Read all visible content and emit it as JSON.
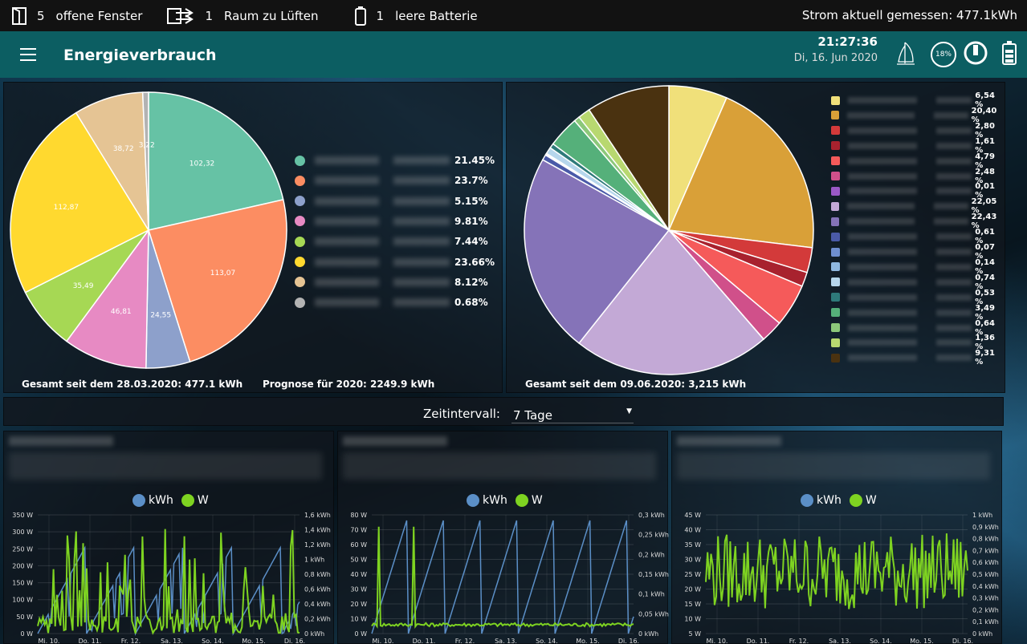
{
  "topbar": {
    "windows_count": "5",
    "windows_label": "offene Fenster",
    "rooms_count": "1",
    "rooms_label": "Raum zu Lüften",
    "battery_count": "1",
    "battery_label": "leere Batterie",
    "power_label": "Strom aktuell gemessen: 477.1kWh"
  },
  "header": {
    "title": "Energieverbrauch",
    "time": "21:27:36",
    "date": "Di, 16. Jun 2020",
    "percent_badge": "18%"
  },
  "pie1": {
    "footer_total": "Gesamt seit dem 28.03.2020: 477.1 kWh",
    "footer_forecast": "Prognose für 2020: 2249.9 kWh",
    "slices": [
      {
        "value": "102,32",
        "color": "#66c2a5",
        "pct": "21.45%"
      },
      {
        "value": "113,07",
        "color": "#fc8d62",
        "pct": "23.7%"
      },
      {
        "value": "24,55",
        "color": "#8da0cb",
        "pct": "5.15%"
      },
      {
        "value": "46,81",
        "color": "#e78ac3",
        "pct": "9.81%"
      },
      {
        "value": "35,49",
        "color": "#a6d854",
        "pct": "7.44%"
      },
      {
        "value": "112,87",
        "color": "#ffd92f",
        "pct": "23.66%"
      },
      {
        "value": "38,72",
        "color": "#e5c494",
        "pct": "8.12%"
      },
      {
        "value": "3,22",
        "color": "#b3b3b3",
        "pct": "0.68%"
      }
    ]
  },
  "pie2": {
    "footer_total": "Gesamt seit dem 09.06.2020: 3,215 kWh",
    "slices": [
      {
        "color": "#f0e07a",
        "pct": "6,54 %"
      },
      {
        "color": "#d9a038",
        "pct": "20,40 %"
      },
      {
        "color": "#d33a3a",
        "pct": "2,80 %"
      },
      {
        "color": "#a8222e",
        "pct": "1,61 %"
      },
      {
        "color": "#f55a5a",
        "pct": "4,79 %"
      },
      {
        "color": "#d0508a",
        "pct": "2,48 %"
      },
      {
        "color": "#9b59c6",
        "pct": "0,01 %"
      },
      {
        "color": "#c3a9d6",
        "pct": "22,05 %"
      },
      {
        "color": "#8573b8",
        "pct": "22,43 %"
      },
      {
        "color": "#4a5aa8",
        "pct": "0,61 %"
      },
      {
        "color": "#6f8fd0",
        "pct": "0,07 %"
      },
      {
        "color": "#8fb8e0",
        "pct": "0,14 %"
      },
      {
        "color": "#b6d6ec",
        "pct": "0,74 %"
      },
      {
        "color": "#2e7a7a",
        "pct": "0,53 %"
      },
      {
        "color": "#55b07a",
        "pct": "3,49 %"
      },
      {
        "color": "#8cc87a",
        "pct": "0,64 %"
      },
      {
        "color": "#b8d870",
        "pct": "1,36 %"
      },
      {
        "color": "#4a3210",
        "pct": "9,31 %"
      }
    ]
  },
  "interval": {
    "label": "Zeitintervall:",
    "value": "7 Tage"
  },
  "charts": [
    {
      "legend_kwh": "kWh",
      "legend_w": "W",
      "left_ticks": [
        "350 W",
        "300 W",
        "250 W",
        "200 W",
        "150 W",
        "100 W",
        "50 W",
        "0 W"
      ],
      "right_ticks": [
        "1,6 kWh",
        "1,4 kWh",
        "1,2 kWh",
        "1 kWh",
        "0,8 kWh",
        "0,6 kWh",
        "0,4 kWh",
        "0,2 kWh",
        "0 kWh"
      ],
      "x_ticks": [
        "Mi. 10.",
        "Do. 11.",
        "Fr. 12.",
        "Sa. 13.",
        "So. 14.",
        "Mo. 15.",
        "Di. 16."
      ]
    },
    {
      "legend_kwh": "kWh",
      "legend_w": "W",
      "left_ticks": [
        "80 W",
        "70 W",
        "60 W",
        "50 W",
        "40 W",
        "30 W",
        "20 W",
        "10 W",
        "0 W"
      ],
      "right_ticks": [
        "0,3 kWh",
        "0,25 kWh",
        "0,2 kWh",
        "0,15 kWh",
        "0,1 kWh",
        "0,05 kWh",
        "0 kWh"
      ],
      "x_ticks": [
        "Mi. 10.",
        "Do. 11.",
        "Fr. 12.",
        "Sa. 13.",
        "So. 14.",
        "Mo. 15.",
        "Di. 16."
      ]
    },
    {
      "legend_kwh": "kWh",
      "legend_w": "W",
      "left_ticks": [
        "45 W",
        "40 W",
        "35 W",
        "30 W",
        "25 W",
        "20 W",
        "15 W",
        "10 W",
        "5 W"
      ],
      "right_ticks": [
        "1 kWh",
        "0,9 kWh",
        "0,8 kWh",
        "0,7 kWh",
        "0,6 kWh",
        "0,5 kWh",
        "0,4 kWh",
        "0,3 kWh",
        "0,2 kWh",
        "0,1 kWh",
        "0 kWh"
      ],
      "x_ticks": [
        "Mi. 10.",
        "Do. 11.",
        "Fr. 12.",
        "Sa. 13.",
        "So. 14.",
        "Mo. 15.",
        "Di. 16."
      ]
    }
  ],
  "colors": {
    "header": "#0c5e62",
    "kwh_series": "#5b8fc7",
    "w_series": "#7ed321"
  }
}
